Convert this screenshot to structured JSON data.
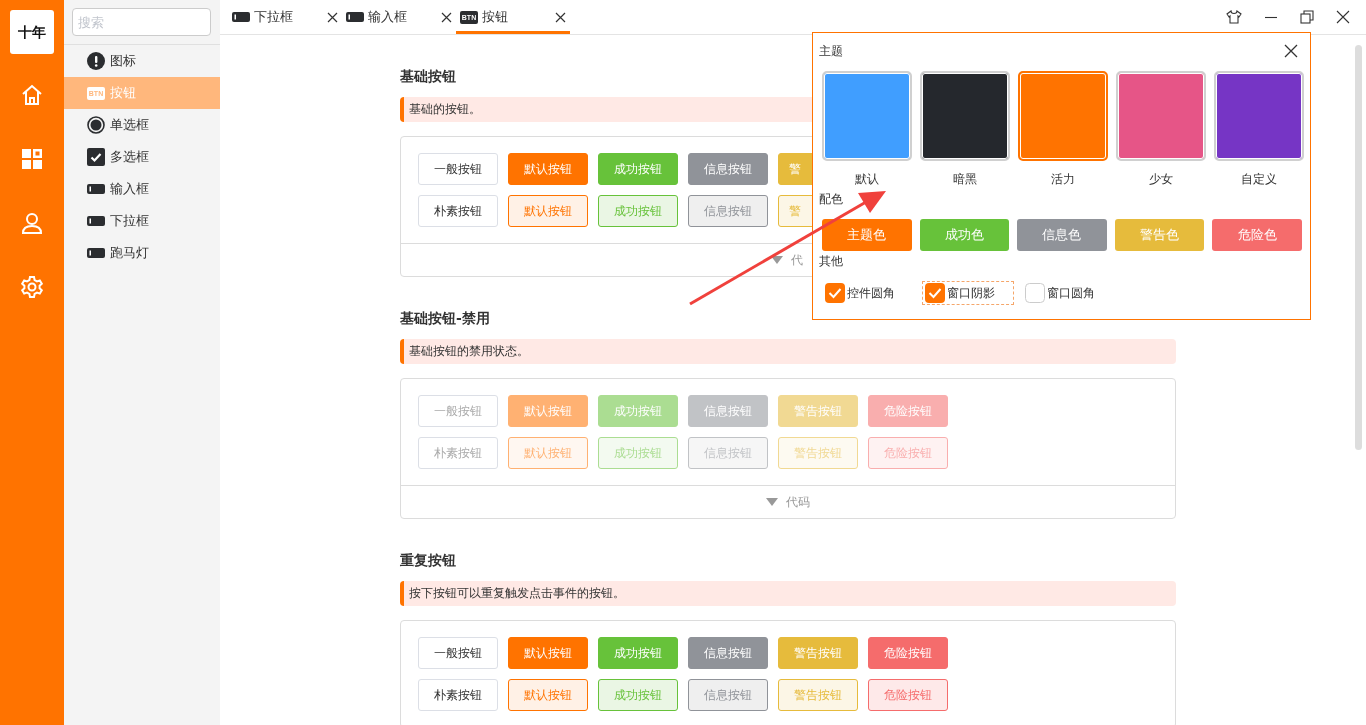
{
  "logo": {
    "text": "十年"
  },
  "sidebar": {
    "search": {
      "placeholder": "搜索"
    },
    "items": [
      {
        "label": "图标",
        "kind": "alert",
        "selected": false
      },
      {
        "label": "按钮",
        "kind": "btn",
        "icon_text": "BTN",
        "selected": true
      },
      {
        "label": "单选框",
        "kind": "radio",
        "selected": false
      },
      {
        "label": "多选框",
        "kind": "check",
        "selected": false
      },
      {
        "label": "输入框",
        "kind": "bar",
        "selected": false
      },
      {
        "label": "下拉框",
        "kind": "bar",
        "selected": false
      },
      {
        "label": "跑马灯",
        "kind": "bar",
        "selected": false
      }
    ]
  },
  "tabs": [
    {
      "label": "下拉框",
      "kind": "bar",
      "selected": false
    },
    {
      "label": "输入框",
      "kind": "bar",
      "selected": false
    },
    {
      "label": "按钮",
      "kind": "btn",
      "icon_text": "BTN",
      "selected": true
    }
  ],
  "sections": [
    {
      "title": "基础按钮",
      "description": "基础的按钮。",
      "disabled": false,
      "rows": [
        [
          {
            "label": "一般按钮",
            "kind": "default"
          },
          {
            "label": "默认按钮",
            "kind": "primary"
          },
          {
            "label": "成功按钮",
            "kind": "success"
          },
          {
            "label": "信息按钮",
            "kind": "info"
          },
          {
            "label": "警",
            "kind": "warning",
            "cut": true
          }
        ],
        [
          {
            "label": "朴素按钮",
            "kind": "default"
          },
          {
            "label": "默认按钮",
            "kind": "primary-plain"
          },
          {
            "label": "成功按钮",
            "kind": "success-plain"
          },
          {
            "label": "信息按钮",
            "kind": "info-plain"
          },
          {
            "label": "警",
            "kind": "warning-plain",
            "cut": true
          }
        ]
      ],
      "code_label": "代",
      "code_cut": true
    },
    {
      "title": "基础按钮-禁用",
      "description": "基础按钮的禁用状态。",
      "disabled": true,
      "rows": [
        [
          {
            "label": "一般按钮",
            "kind": "default"
          },
          {
            "label": "默认按钮",
            "kind": "primary"
          },
          {
            "label": "成功按钮",
            "kind": "success"
          },
          {
            "label": "信息按钮",
            "kind": "info"
          },
          {
            "label": "警告按钮",
            "kind": "warning"
          },
          {
            "label": "危险按钮",
            "kind": "danger"
          }
        ],
        [
          {
            "label": "朴素按钮",
            "kind": "default"
          },
          {
            "label": "默认按钮",
            "kind": "primary-plain"
          },
          {
            "label": "成功按钮",
            "kind": "success-plain"
          },
          {
            "label": "信息按钮",
            "kind": "info-plain"
          },
          {
            "label": "警告按钮",
            "kind": "warning-plain"
          },
          {
            "label": "危险按钮",
            "kind": "danger-plain"
          }
        ]
      ],
      "code_label": "代码"
    },
    {
      "title": "重复按钮",
      "description": "按下按钮可以重复触发点击事件的按钮。",
      "disabled": false,
      "rows": [
        [
          {
            "label": "一般按钮",
            "kind": "default"
          },
          {
            "label": "默认按钮",
            "kind": "primary"
          },
          {
            "label": "成功按钮",
            "kind": "success"
          },
          {
            "label": "信息按钮",
            "kind": "info"
          },
          {
            "label": "警告按钮",
            "kind": "warning"
          },
          {
            "label": "危险按钮",
            "kind": "danger"
          }
        ],
        [
          {
            "label": "朴素按钮",
            "kind": "default"
          },
          {
            "label": "默认按钮",
            "kind": "primary-plain"
          },
          {
            "label": "成功按钮",
            "kind": "success-plain"
          },
          {
            "label": "信息按钮",
            "kind": "info-plain"
          },
          {
            "label": "警告按钮",
            "kind": "warning-plain"
          },
          {
            "label": "危险按钮",
            "kind": "danger-plain"
          }
        ]
      ]
    }
  ],
  "theme_popup": {
    "title": "主题",
    "themes": [
      {
        "label": "默认",
        "color": "#409eff",
        "selected": false
      },
      {
        "label": "暗黑",
        "color": "#25282d",
        "selected": false
      },
      {
        "label": "活力",
        "color": "#ff7300",
        "selected": true
      },
      {
        "label": "少女",
        "color": "#e65587",
        "selected": false
      },
      {
        "label": "自定义",
        "color": "#7635c5",
        "selected": false
      }
    ],
    "palette_title": "配色",
    "palette": [
      {
        "label": "主题色",
        "color": "#ff7300"
      },
      {
        "label": "成功色",
        "color": "#67c23a"
      },
      {
        "label": "信息色",
        "color": "#909399"
      },
      {
        "label": "警告色",
        "color": "#e6bb3c"
      },
      {
        "label": "危险色",
        "color": "#f56c6c"
      }
    ],
    "other_title": "其他",
    "options": [
      {
        "label": "控件圆角",
        "checked": true,
        "focused": false
      },
      {
        "label": "窗口阴影",
        "checked": true,
        "focused": true
      },
      {
        "label": "窗口圆角",
        "checked": false,
        "focused": false
      }
    ]
  }
}
